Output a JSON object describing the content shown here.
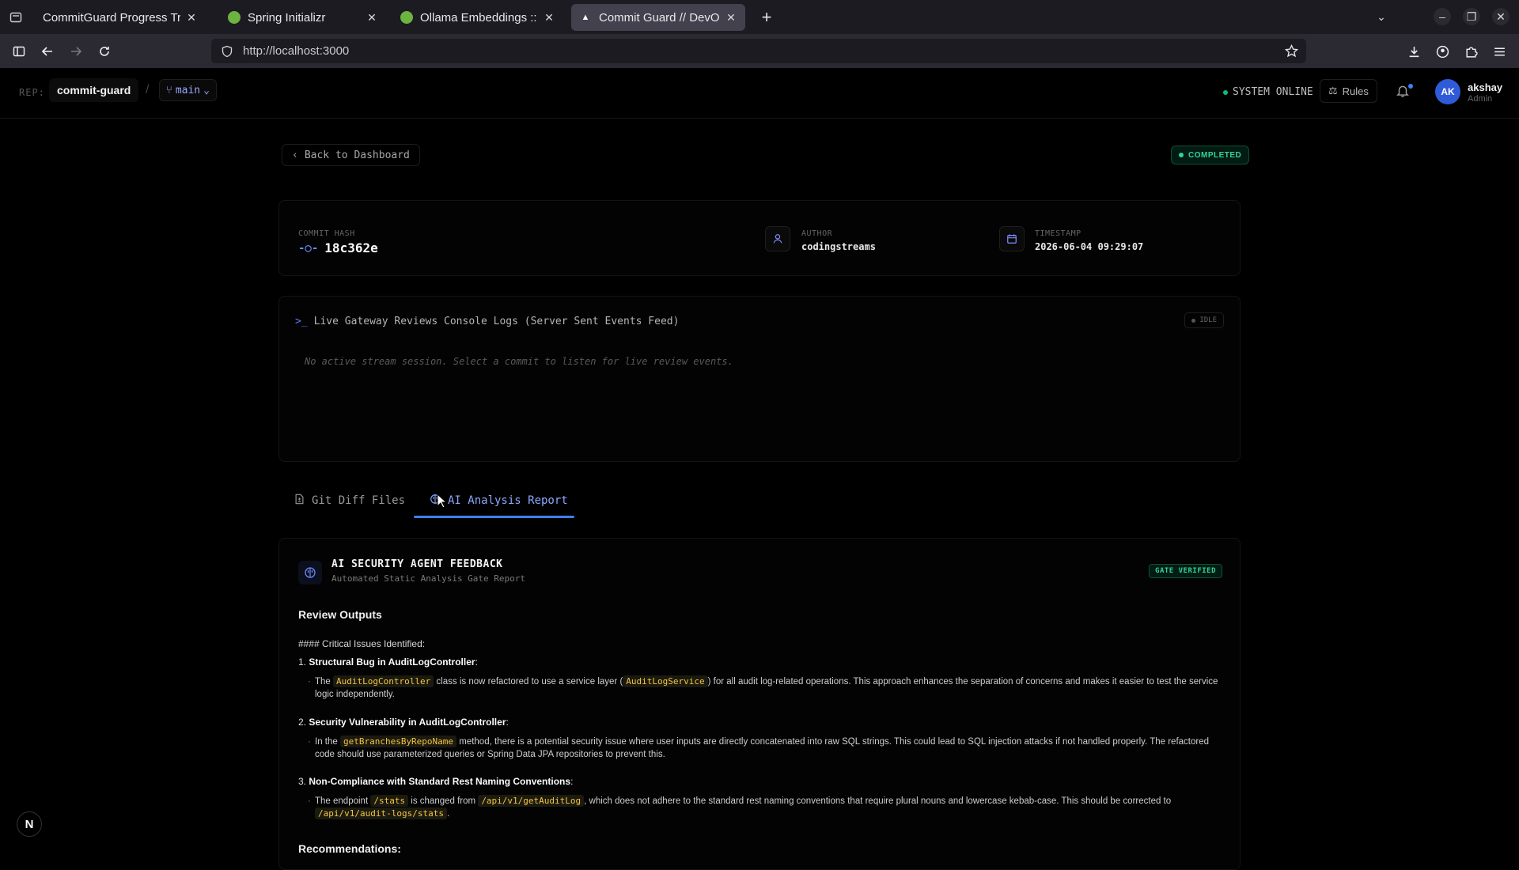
{
  "browser": {
    "tabs": [
      {
        "title": "CommitGuard Progress Track",
        "favicon_color": "#1c1b22"
      },
      {
        "title": "Spring Initializr",
        "favicon_color": "#6db33f"
      },
      {
        "title": "Ollama Embeddings :: Spr",
        "favicon_color": "#6db33f"
      },
      {
        "title": "Commit Guard // DevOps",
        "favicon_color": "#ffffff"
      }
    ],
    "url": "http://localhost:3000"
  },
  "header": {
    "repo_label": "REP:",
    "repo_name": "commit-guard",
    "separator": "/",
    "branch": "main",
    "system_status": "SYSTEM ONLINE",
    "rules_label": "Rules",
    "user_initials": "AK",
    "user_name": "akshay",
    "user_role": "Admin"
  },
  "page": {
    "back_label": "Back to Dashboard",
    "status": "COMPLETED",
    "commit": {
      "hash_label": "COMMIT HASH",
      "hash": "18c362e",
      "author_label": "AUTHOR",
      "author": "codingstreams",
      "timestamp_label": "TIMESTAMP",
      "timestamp": "2026-06-04 09:29:07"
    },
    "logs": {
      "title": "Live Gateway Reviews Console Logs (Server Sent Events Feed)",
      "state": "IDLE",
      "empty_message": "No active stream session. Select a commit to listen for live review events."
    },
    "tabs": [
      {
        "label": "Git Diff Files"
      },
      {
        "label": "AI Analysis Report"
      }
    ],
    "report": {
      "title": "AI SECURITY AGENT FEEDBACK",
      "subtitle": "Automated Static Analysis Gate Report",
      "gate": "GATE VERIFIED",
      "section_title": "Review Outputs",
      "critical_heading": "#### Critical Issues Identified:",
      "items": [
        {
          "num": "1.",
          "title": "Structural Bug in AuditLogController",
          "suffix": ":",
          "t1": "The ",
          "c1": "AuditLogController",
          "t2": " class is now refactored to use a service layer (",
          "c2": "AuditLogService",
          "t3": ") for all audit log-related operations. This approach enhances the separation of concerns and makes it easier to test the service logic independently."
        },
        {
          "num": "2.",
          "title": "Security Vulnerability in AuditLogController",
          "suffix": ":",
          "t1": "In the ",
          "c1": "getBranchesByRepoName",
          "t2": " method, there is a potential security issue where user inputs are directly concatenated into raw SQL strings. This could lead to SQL injection attacks if not handled properly. The refactored code should use parameterized queries or Spring Data JPA repositories to prevent this."
        },
        {
          "num": "3.",
          "title": "Non-Compliance with Standard Rest Naming Conventions",
          "suffix": ":",
          "t1": "The endpoint ",
          "c1": "/stats",
          "t2": " is changed from ",
          "c2": "/api/v1/getAuditLog",
          "t3": ", which does not adhere to the standard rest naming conventions that require plural nouns and lowercase kebab-case. This should be corrected to ",
          "c3": "/api/v1/audit-logs/stats",
          "t4": "."
        }
      ],
      "recommendations_heading": "Recommendations:"
    },
    "next_badge": "N"
  }
}
